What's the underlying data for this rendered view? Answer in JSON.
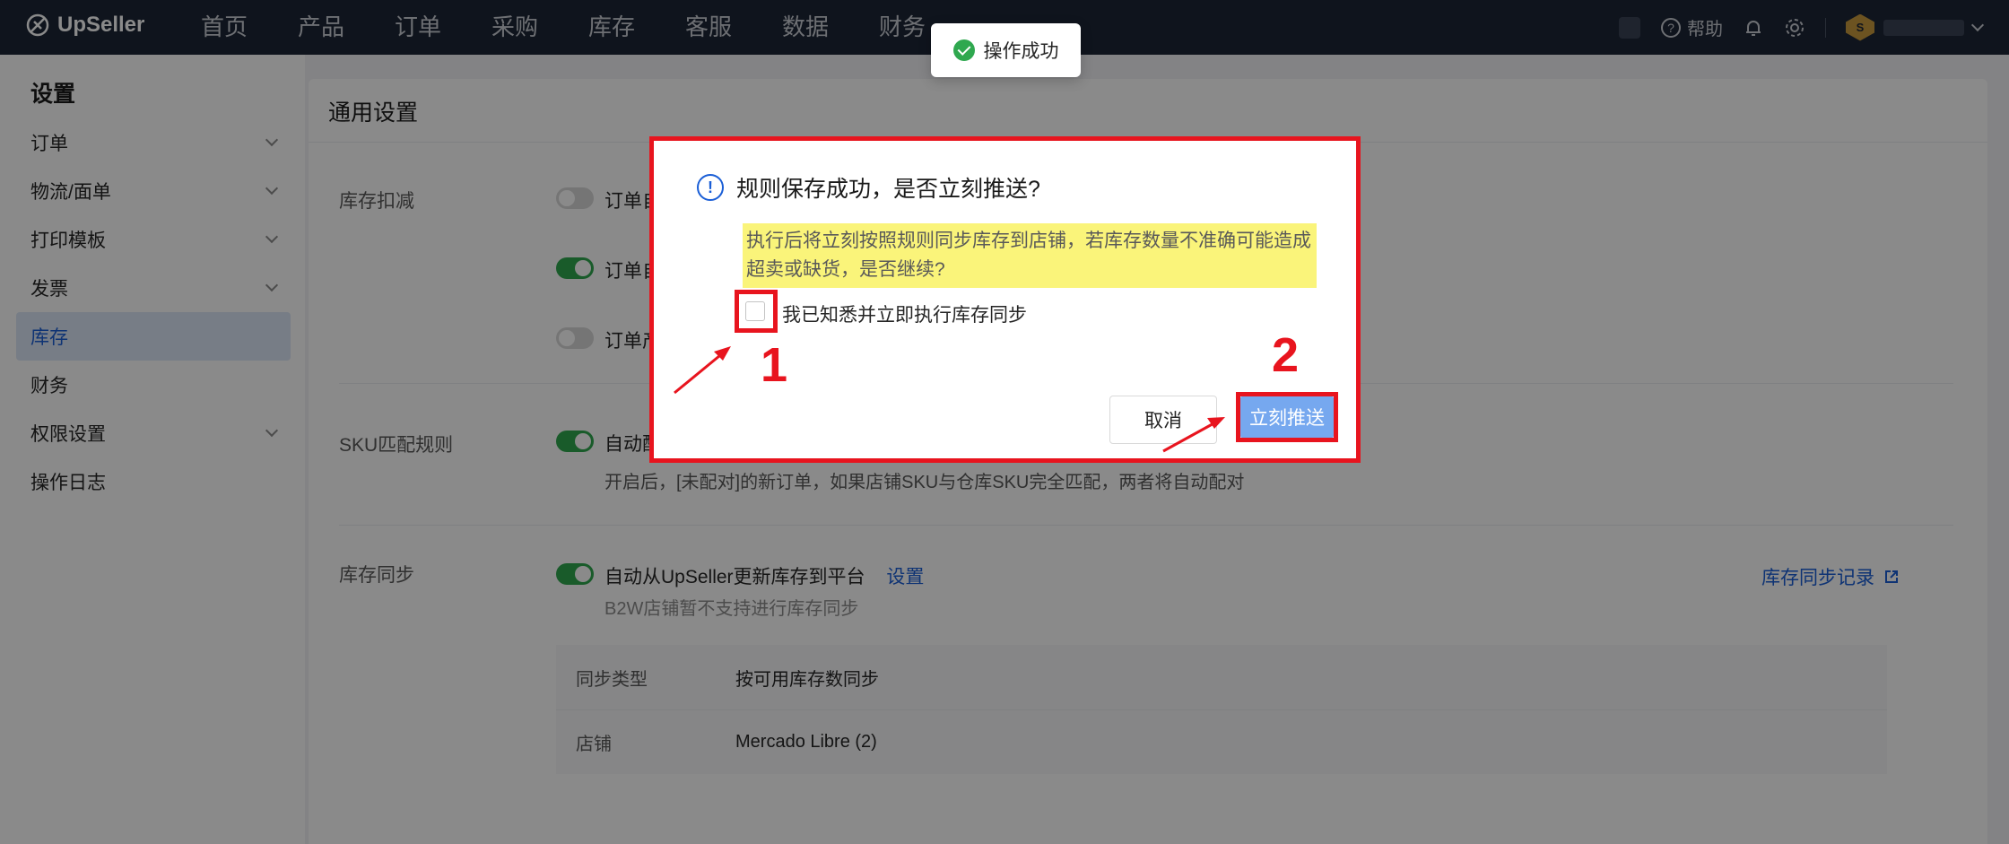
{
  "app": {
    "name": "UpSeller"
  },
  "nav": {
    "items": [
      "首页",
      "产品",
      "订单",
      "采购",
      "库存",
      "客服",
      "数据",
      "财务"
    ]
  },
  "topbar": {
    "help": "帮助",
    "account_initial": "S"
  },
  "toast": {
    "message": "操作成功"
  },
  "sidebar": {
    "title": "设置",
    "items": [
      {
        "label": "订单",
        "expandable": true
      },
      {
        "label": "物流/面单",
        "expandable": true
      },
      {
        "label": "打印模板",
        "expandable": true
      },
      {
        "label": "发票",
        "expandable": true
      },
      {
        "label": "库存",
        "expandable": false,
        "active": true
      },
      {
        "label": "财务",
        "expandable": false
      },
      {
        "label": "权限设置",
        "expandable": true
      },
      {
        "label": "操作日志",
        "expandable": false
      }
    ]
  },
  "main": {
    "title": "通用设置",
    "inventory_deduct": {
      "label": "库存扣减",
      "options": [
        {
          "text": "订单自",
          "on": false
        },
        {
          "text": "订单自",
          "on": true
        },
        {
          "text": "订单产",
          "on": false
        }
      ]
    },
    "sku_match": {
      "label": "SKU匹配规则",
      "option": "自动配",
      "on": true,
      "desc": "开启后，[未配对]的新订单，如果店铺SKU与仓库SKU完全匹配，两者将自动配对"
    },
    "inventory_sync": {
      "label": "库存同步",
      "option": "自动从UpSeller更新库存到平台",
      "on": true,
      "settings_link": "设置",
      "note": "B2W店铺暂不支持进行库存同步",
      "record_link": "库存同步记录",
      "table": [
        {
          "key": "同步类型",
          "value": "按可用库存数同步"
        },
        {
          "key": "店铺",
          "value": "Mercado Libre (2)"
        }
      ]
    }
  },
  "dialog": {
    "title": "规则保存成功，是否立刻推送?",
    "warning": "执行后将立刻按照规则同步库存到店铺，若库存数量不准确可能造成超卖或缺货，是否继续?",
    "checkbox_label": "我已知悉并立即执行库存同步",
    "checked": false,
    "cancel": "取消",
    "confirm": "立刻推送"
  },
  "annotations": {
    "step1": "1",
    "step2": "2",
    "color": "#e8141e"
  }
}
